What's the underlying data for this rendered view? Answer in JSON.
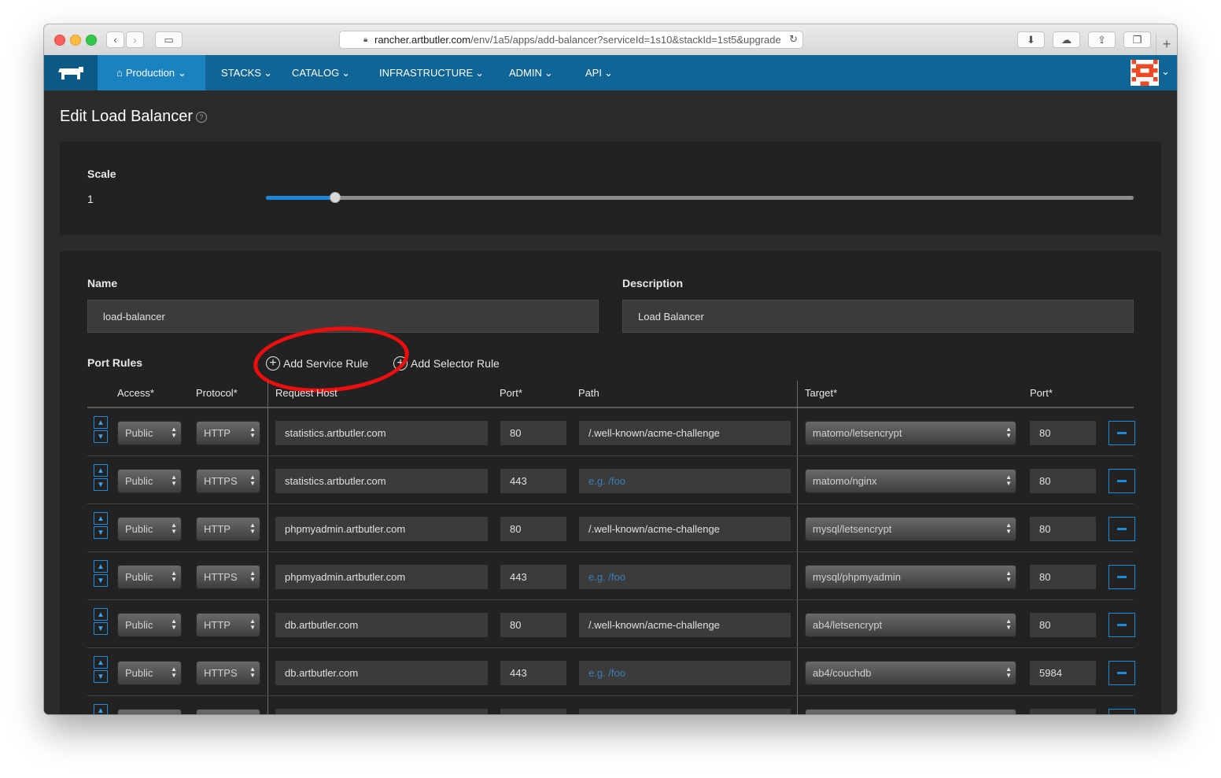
{
  "browser": {
    "url_host": "rancher.artbutler.com",
    "url_path": "/env/1a5/apps/add-balancer?serviceId=1s10&stackId=1st5&upgrade"
  },
  "nav": {
    "environment": "Production",
    "items": [
      "STACKS",
      "CATALOG",
      "INFRASTRUCTURE",
      "ADMIN",
      "API"
    ]
  },
  "page": {
    "title": "Edit Load Balancer",
    "help_icon": "?"
  },
  "scale": {
    "label": "Scale",
    "value": "1",
    "slider_fraction": 0.08
  },
  "form": {
    "name_label": "Name",
    "name_value": "load-balancer",
    "description_label": "Description",
    "description_value": "Load Balancer"
  },
  "port_rules": {
    "label": "Port Rules",
    "add_service_rule": "Add Service Rule",
    "add_selector_rule": "Add Selector Rule",
    "headers": {
      "access": "Access*",
      "protocol": "Protocol*",
      "request_host": "Request Host",
      "port": "Port*",
      "path": "Path",
      "target": "Target*",
      "target_port": "Port*"
    },
    "path_placeholder": "e.g. /foo",
    "rows": [
      {
        "access": "Public",
        "protocol": "HTTP",
        "host": "statistics.artbutler.com",
        "port": "80",
        "path": "/.well-known/acme-challenge",
        "target": "matomo/letsencrypt",
        "target_port": "80"
      },
      {
        "access": "Public",
        "protocol": "HTTPS",
        "host": "statistics.artbutler.com",
        "port": "443",
        "path": "",
        "target": "matomo/nginx",
        "target_port": "80"
      },
      {
        "access": "Public",
        "protocol": "HTTP",
        "host": "phpmyadmin.artbutler.com",
        "port": "80",
        "path": "/.well-known/acme-challenge",
        "target": "mysql/letsencrypt",
        "target_port": "80"
      },
      {
        "access": "Public",
        "protocol": "HTTPS",
        "host": "phpmyadmin.artbutler.com",
        "port": "443",
        "path": "",
        "target": "mysql/phpmyadmin",
        "target_port": "80"
      },
      {
        "access": "Public",
        "protocol": "HTTP",
        "host": "db.artbutler.com",
        "port": "80",
        "path": "/.well-known/acme-challenge",
        "target": "ab4/letsencrypt",
        "target_port": "80"
      },
      {
        "access": "Public",
        "protocol": "HTTPS",
        "host": "db.artbutler.com",
        "port": "443",
        "path": "",
        "target": "ab4/couchdb",
        "target_port": "5984"
      }
    ]
  }
}
